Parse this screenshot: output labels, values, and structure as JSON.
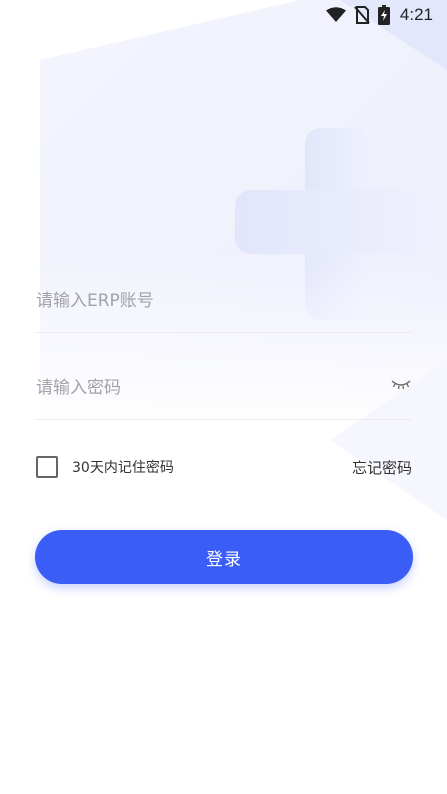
{
  "status_bar": {
    "time": "4:21",
    "icons": [
      "wifi-icon",
      "no-sim-icon",
      "battery-charging-icon"
    ]
  },
  "login_form": {
    "account_placeholder": "请输入ERP账号",
    "password_placeholder": "请输入密码",
    "password_toggle_icon": "eye-closed-icon",
    "remember_label": "30天内记住密码",
    "remember_checked": false,
    "forgot_label": "忘记密码",
    "submit_label": "登录"
  },
  "colors": {
    "accent": "#3a5df6",
    "placeholder": "#a2a2a8",
    "text": "#333333",
    "background_tint": "#e8ebfb"
  }
}
